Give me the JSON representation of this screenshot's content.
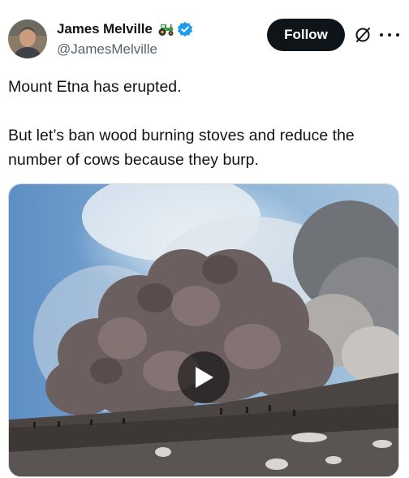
{
  "user": {
    "display_name": "James Melville",
    "handle": "@JamesMelville",
    "badge_emoji_icon": "tractor-icon",
    "verified": true,
    "verified_color": "#1d9bf0"
  },
  "actions": {
    "follow_label": "Follow",
    "grok_icon": "grok-icon",
    "more_icon": "more-icon"
  },
  "tweet": {
    "line1": "Mount Etna has erupted.",
    "line2": "But let’s ban wood burning stoves and reduce the number of cows because they burp."
  },
  "media": {
    "type": "video",
    "play_icon": "play-icon"
  },
  "colors": {
    "text": "#0f1419",
    "secondary": "#536471",
    "follow_bg": "#0f1419"
  }
}
